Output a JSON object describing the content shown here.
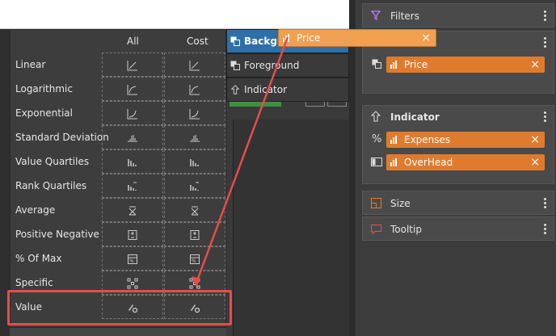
{
  "menu": {
    "columns": [
      "All",
      "Cost"
    ],
    "rows": [
      {
        "label": "Linear",
        "icon": "linear-trend-icon"
      },
      {
        "label": "Logarithmic",
        "icon": "logarithmic-trend-icon"
      },
      {
        "label": "Exponential",
        "icon": "exponential-trend-icon"
      },
      {
        "label": "Standard Deviation",
        "icon": "standard-deviation-icon"
      },
      {
        "label": "Value Quartiles",
        "icon": "value-quartiles-icon"
      },
      {
        "label": "Rank Quartiles",
        "icon": "rank-quartiles-icon"
      },
      {
        "label": "Average",
        "icon": "average-icon"
      },
      {
        "label": "Positive Negative",
        "icon": "positive-negative-icon"
      },
      {
        "label": "% Of Max",
        "icon": "percent-of-max-icon"
      },
      {
        "label": "Specific",
        "icon": "specific-icon"
      },
      {
        "label": "Value",
        "icon": "value-settings-icon"
      }
    ]
  },
  "tabs": {
    "background": "Backgro",
    "foreground": "Foreground",
    "indicator": "Indicator"
  },
  "drag_pill": {
    "label": "Price",
    "close": "×"
  },
  "right_panel": {
    "filters": {
      "title": "Filters"
    },
    "top_card": {
      "pill": {
        "label": "Price",
        "close": "×"
      }
    },
    "indicator": {
      "title": "Indicator",
      "pills": [
        {
          "label": "Expenses",
          "close": "×"
        },
        {
          "label": "OverHead",
          "close": "×"
        }
      ]
    },
    "size": {
      "title": "Size"
    },
    "tooltip": {
      "title": "Tooltip"
    }
  },
  "colors": {
    "accent": "#e07b2e",
    "drag_pill": "#f0a050",
    "active_tab": "#2e6fa8",
    "highlight": "#e74c4c",
    "filter_icon": "#c77dff"
  }
}
